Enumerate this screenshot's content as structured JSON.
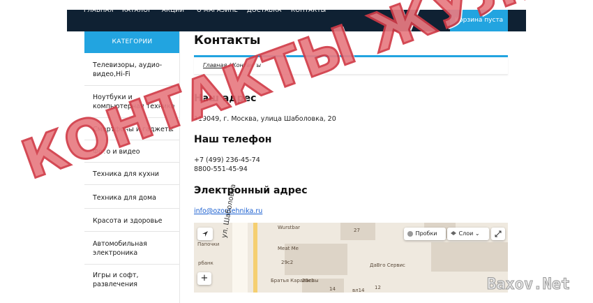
{
  "nav": {
    "items": [
      "ГЛАВНАЯ",
      "КАТАЛОГ",
      "АКЦИИ",
      "О МАГАЗИНЕ",
      "ДОСТАВКА",
      "КОНТАКТЫ"
    ],
    "cart": "Корзина пуста"
  },
  "sidebar": {
    "heading": "КАТЕГОРИИ",
    "items": [
      "Телевизоры, аудио-видео,Hi-Fi",
      "Ноутбуки и компьютерная техника",
      "Смартфоны и гаджеты",
      "Фото и видео",
      "Техника для кухни",
      "Техника для дома",
      "Красота и здоровье",
      "Автомобильная электроника",
      "Игры и софт, развлечения"
    ]
  },
  "main": {
    "title": "Контакты",
    "breadcrumb": {
      "home": "Главная",
      "sep": " / ",
      "current": "Контакты"
    },
    "address_heading": "Наш адрес",
    "address": "119049, г. Москва, улица Шаболовка, 20",
    "phone_heading": "Наш телефон",
    "phones": [
      "+7 (499) 236-45-74",
      "8800-551-45-94"
    ],
    "email_heading": "Электронный адрес",
    "email": "info@ozontehnika.ru"
  },
  "map": {
    "traffic": "Пробки",
    "layers": "Слои",
    "street": "ул. Шаболовка",
    "labels": [
      "Wurstbar",
      "Meat Me",
      "Братья Караваевы",
      "ДаВго Сервис",
      "Папочки",
      "29с2",
      "29с1",
      "27",
      "14",
      "12",
      "вл14",
      "рбанк"
    ],
    "zoom_in": "+"
  },
  "overlay": {
    "stamp": "КОНТАКТЫ ЖУЛИКОВ",
    "watermark": "Baxov.Net",
    "stamp_color": "#d13b47"
  }
}
